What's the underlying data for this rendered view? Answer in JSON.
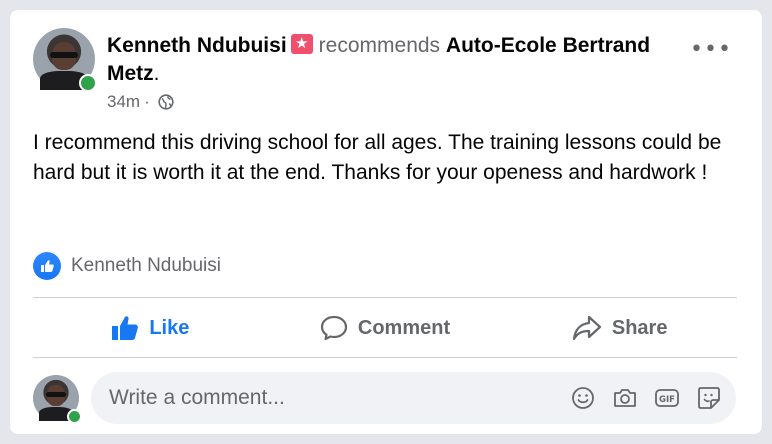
{
  "post": {
    "author": "Kenneth Ndubuisi",
    "verb": "recommends",
    "target": "Auto-Ecole Bertrand Metz",
    "suffix": ".",
    "time": "34m",
    "separator": "·",
    "privacy_icon": "globe-icon",
    "text": "I recommend this driving school for all ages. The training lessons could be hard but it is worth it at the end. Thanks for your openess and hardwork !",
    "reaction_names": "Kenneth Ndubuisi",
    "more_label": "•••"
  },
  "actions": {
    "like_label": "Like",
    "comment_label": "Comment",
    "share_label": "Share",
    "like_active": true
  },
  "comment": {
    "placeholder": "Write a comment...",
    "tools": [
      "emoji-icon",
      "camera-icon",
      "gif-icon",
      "sticker-icon"
    ]
  },
  "colors": {
    "brand_blue": "#1877f2",
    "online_green": "#31a24c",
    "recommend_badge": "#f0506e",
    "secondary_text": "#65676b"
  }
}
